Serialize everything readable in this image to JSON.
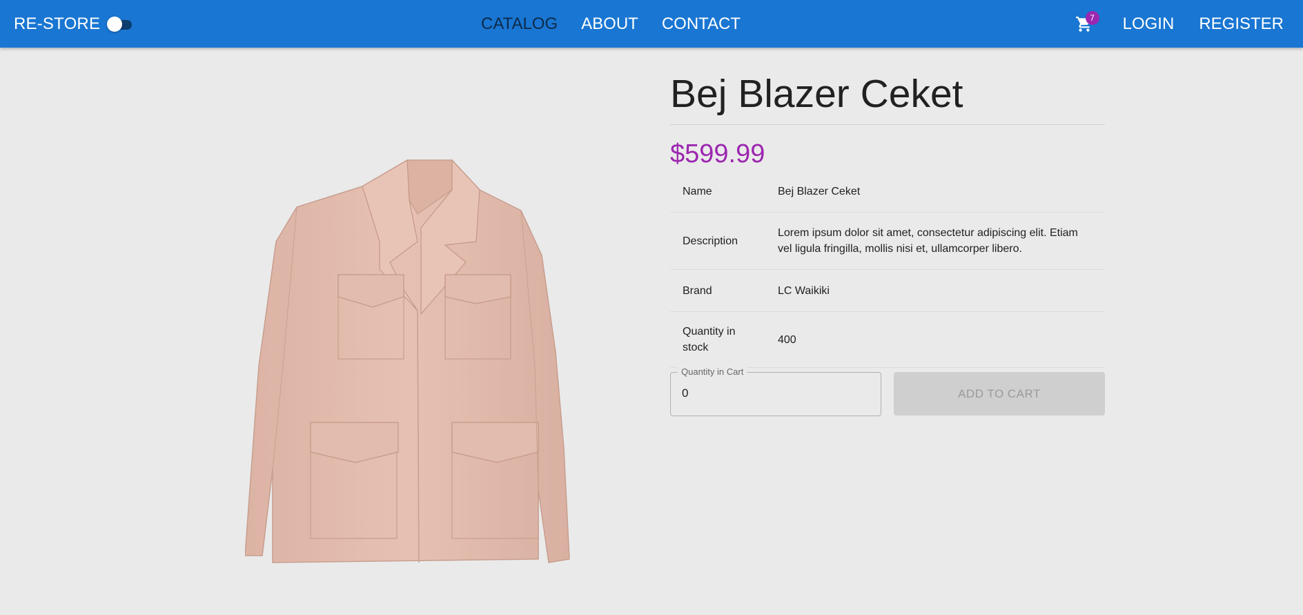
{
  "app": {
    "brand": "RE-STORE",
    "theme_toggle_on": false,
    "nav": [
      {
        "label": "CATALOG",
        "active": true
      },
      {
        "label": "ABOUT",
        "active": false
      },
      {
        "label": "CONTACT",
        "active": false
      }
    ],
    "cart_count": "7",
    "login_label": "LOGIN",
    "register_label": "REGISTER"
  },
  "product": {
    "title": "Bej Blazer Ceket",
    "price": "$599.99",
    "image_icon": "blazer-jacket-image",
    "details": [
      {
        "key": "Name",
        "value": "Bej Blazer Ceket"
      },
      {
        "key": "Description",
        "value": "Lorem ipsum dolor sit amet, consectetur adipiscing elit. Etiam vel ligula fringilla, mollis nisi et, ullamcorper libero."
      },
      {
        "key": "Brand",
        "value": "LC Waikiki"
      },
      {
        "key": "Quantity in stock",
        "value": "400"
      }
    ],
    "quantity_label": "Quantity in Cart",
    "quantity_value": "0",
    "add_to_cart_label": "ADD TO CART",
    "add_to_cart_disabled": true
  },
  "colors": {
    "appbar": "#1976d2",
    "accent_price": "#9c27b0",
    "background": "#eaeaea",
    "jacket": "#e3bcae"
  }
}
